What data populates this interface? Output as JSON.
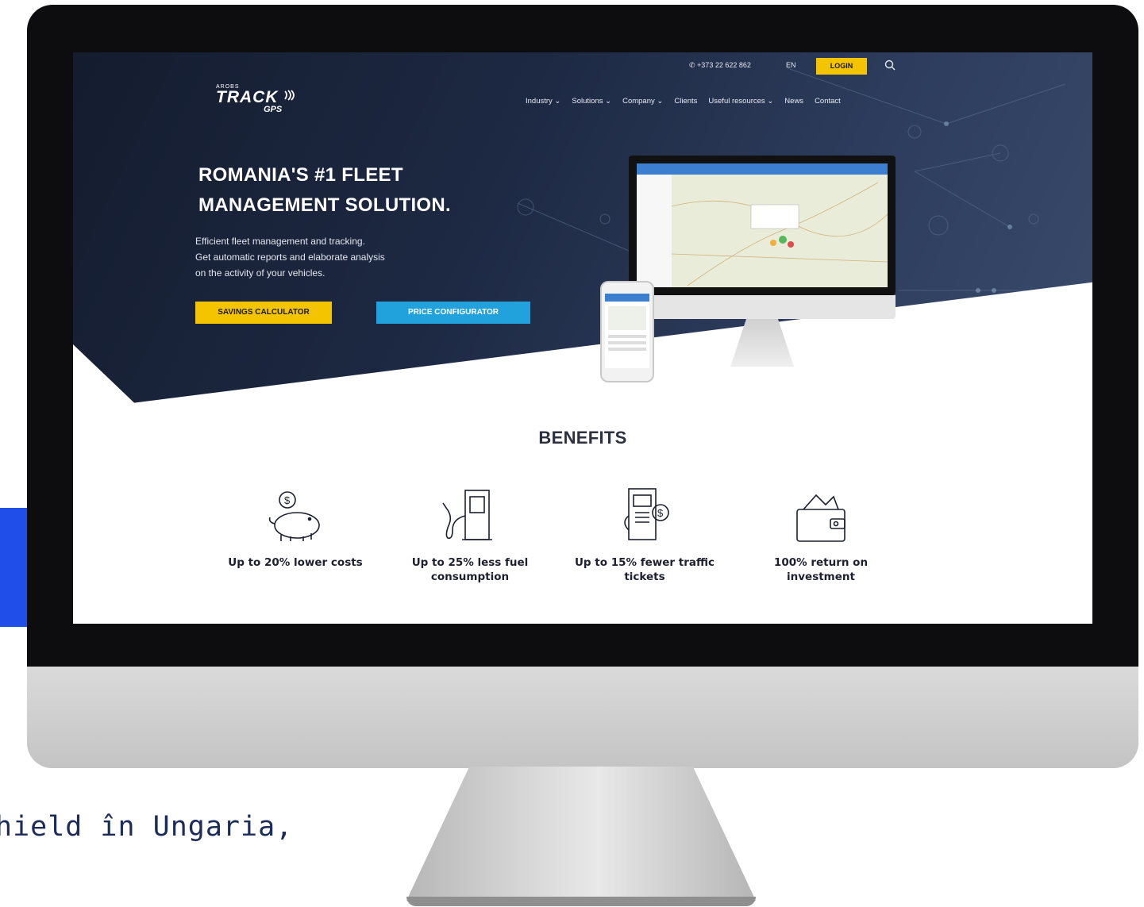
{
  "topbar": {
    "phone": "+373 22 622 862",
    "language": "EN",
    "login_label": "LOGIN"
  },
  "logo": {
    "small": "AROBS",
    "main": "TRACK",
    "sub": "GPS"
  },
  "nav": {
    "items": [
      {
        "label": "Industry ⌄"
      },
      {
        "label": "Solutions ⌄"
      },
      {
        "label": "Company ⌄"
      },
      {
        "label": "Clients"
      },
      {
        "label": "Useful resources ⌄"
      },
      {
        "label": "News"
      },
      {
        "label": "Contact"
      }
    ]
  },
  "hero": {
    "headline_line1": "ROMANIA'S #1 FLEET",
    "headline_line2": "MANAGEMENT SOLUTION.",
    "sub_line1": "Efficient fleet management and tracking.",
    "sub_line2": "Get automatic reports and elaborate analysis",
    "sub_line3": "on the activity of your vehicles.",
    "btn_savings": "SAVINGS CALCULATOR",
    "btn_price": "PRICE CONFIGURATOR"
  },
  "benefits": {
    "title": "BENEFITS",
    "items": [
      {
        "line1": "Up to 20% lower costs",
        "line2": "",
        "icon": "piggy-bank-icon"
      },
      {
        "line1": "Up to 25% less fuel",
        "line2": "consumption",
        "icon": "fuel-pump-icon"
      },
      {
        "line1": "Up to 15% fewer traffic",
        "line2": "tickets",
        "icon": "ticket-machine-icon"
      },
      {
        "line1": "100% return on",
        "line2": "investment",
        "icon": "wallet-icon"
      }
    ]
  },
  "page": {
    "bottom_text": "hield în Ungaria,"
  },
  "colors": {
    "accent_yellow": "#f5c400",
    "accent_blue": "#22a2dd",
    "hero_dark": "#1d2943",
    "side_blue": "#1f4ee8"
  }
}
